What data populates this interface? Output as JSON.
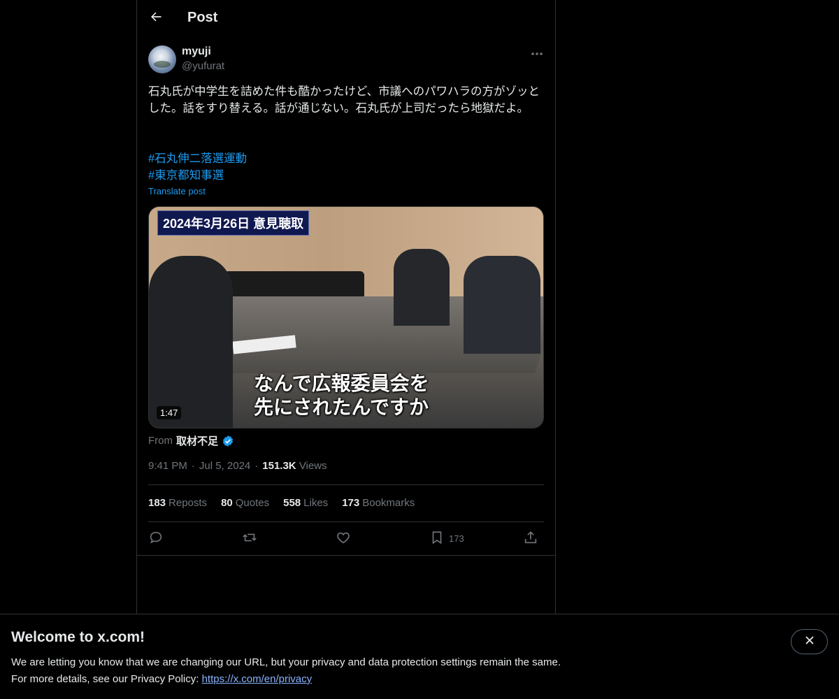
{
  "header": {
    "title": "Post",
    "back_icon": "arrow-left-icon"
  },
  "author": {
    "display_name": "myuji",
    "handle": "@yufurat"
  },
  "tweet": {
    "text": "石丸氏が中学生を詰めた件も酷かったけど、市議へのパワハラの方がゾッとした。話をすり替える。話が通じない。石丸氏が上司だったら地獄だよ。",
    "hashtags": [
      "#石丸伸二落選運動",
      "#東京都知事選"
    ],
    "translate_label": "Translate post"
  },
  "media": {
    "caption_badge": "2024年3月26日 意見聴取",
    "subtitle_line1": "なんで広報委員会を",
    "subtitle_line2": "先にされたんですか",
    "duration": "1:47"
  },
  "source": {
    "from_label": "From",
    "name": "取材不足"
  },
  "meta": {
    "time": "9:41 PM",
    "date": "Jul 5, 2024",
    "views_count": "151.3K",
    "views_label": "Views",
    "separator": "·"
  },
  "stats": {
    "reposts_count": "183",
    "reposts_label": "Reposts",
    "quotes_count": "80",
    "quotes_label": "Quotes",
    "likes_count": "558",
    "likes_label": "Likes",
    "bookmarks_count": "173",
    "bookmarks_label": "Bookmarks"
  },
  "actions": {
    "bookmark_count": "173"
  },
  "banner": {
    "title": "Welcome to x.com!",
    "line1": "We are letting you know that we are changing our URL, but your privacy and data protection settings remain the same.",
    "line2_prefix": "For more details, see our Privacy Policy: ",
    "link": "https://x.com/en/privacy"
  },
  "colors": {
    "accent": "#1d9bf0",
    "background": "#000000",
    "muted": "#71767b",
    "border": "#2f3336"
  }
}
